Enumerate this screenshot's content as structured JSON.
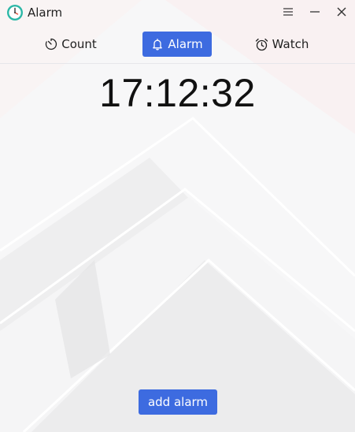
{
  "window": {
    "title": "Alarm",
    "controls": [
      "menu-icon",
      "minimize-icon",
      "close-icon"
    ]
  },
  "tabs": [
    {
      "label": "Count",
      "icon": "timer-icon",
      "active": false
    },
    {
      "label": "Alarm",
      "icon": "bell-icon",
      "active": true
    },
    {
      "label": "Watch",
      "icon": "alarm-clock-icon",
      "active": false
    }
  ],
  "clock": {
    "time": "17:12:32"
  },
  "actions": {
    "add_alarm_label": "add alarm"
  },
  "colors": {
    "accent": "#3d6be0",
    "app_icon_ring": "#2bb7a6"
  }
}
